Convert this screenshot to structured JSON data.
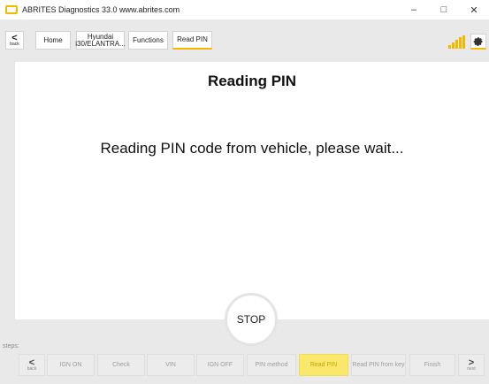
{
  "window": {
    "title": "ABRITES Diagnostics 33.0  www.abrites.com",
    "minimize": "–",
    "maximize": "□",
    "close": "✕"
  },
  "nav": {
    "back_arrow": "<",
    "back_label": "back",
    "home": "Home",
    "model": "Hyundai i30/ELANTRA...",
    "functions": "Functions",
    "read_pin": "Read PIN"
  },
  "main": {
    "title": "Reading PIN",
    "message": "Reading PIN code from vehicle, please wait..."
  },
  "stop_label": "STOP",
  "steps": {
    "label": "steps:",
    "back_arrow": "<",
    "back_label": "back",
    "next_arrow": ">",
    "next_label": "next",
    "items": [
      {
        "label": "IGN ON"
      },
      {
        "label": "Check"
      },
      {
        "label": "VIN"
      },
      {
        "label": "IGN OFF"
      },
      {
        "label": "PIN method"
      },
      {
        "label": "Read PIN",
        "active": true
      },
      {
        "label": "Read PIN from key"
      },
      {
        "label": "Finish"
      }
    ]
  },
  "colors": {
    "accent": "#f5b800",
    "active_step_bg": "#f9e86c"
  },
  "icons": [
    "app-icon",
    "signal-icon",
    "settings-gear-icon"
  ]
}
